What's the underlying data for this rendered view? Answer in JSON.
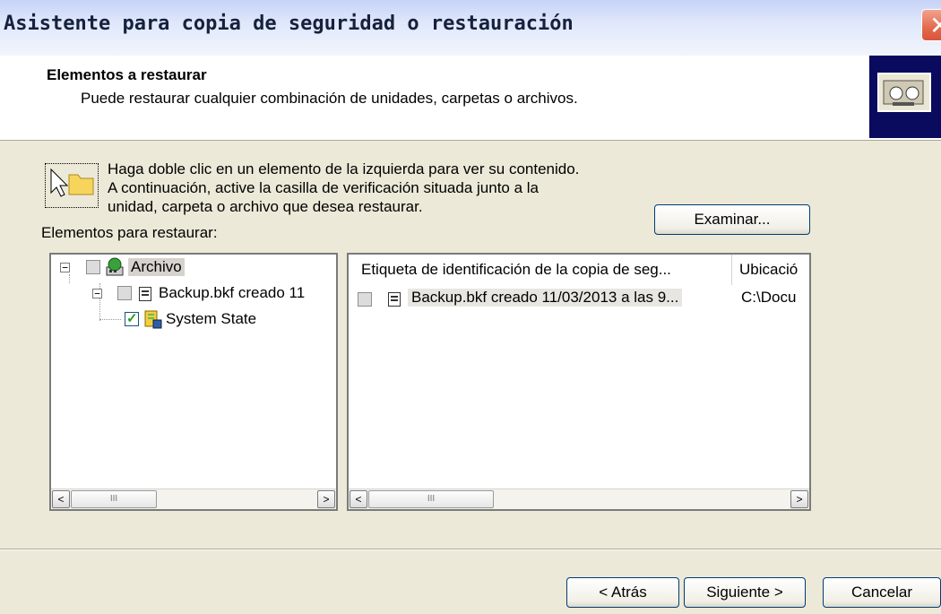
{
  "window": {
    "title": "Asistente para copia de seguridad o restauración"
  },
  "header": {
    "title": "Elementos a restaurar",
    "subtitle": "Puede restaurar cualquier combinación de unidades, carpetas o archivos."
  },
  "hint": {
    "line1": "Haga doble clic en un elemento de la izquierda para ver su contenido.",
    "line2": "A continuación, active la casilla de verificación situada junto a la",
    "line3": "unidad, carpeta o archivo que desea restaurar."
  },
  "items_label": "Elementos para restaurar:",
  "browse_label": "Examinar...",
  "tree": {
    "root": {
      "label": "Archivo",
      "expander": "−"
    },
    "child": {
      "label": "Backup.bkf creado 11",
      "expander": "−"
    },
    "grandchild": {
      "label": "System State",
      "checked": true
    }
  },
  "list": {
    "columns": [
      "Etiqueta de identificación de la copia de seg...",
      "Ubicació"
    ],
    "rows": [
      {
        "label": "Backup.bkf creado 11/03/2013 a las 9...",
        "location": "C:\\Docu"
      }
    ]
  },
  "scroll": {
    "left_arrow": "<",
    "right_arrow": ">",
    "grip": "III"
  },
  "footer": {
    "back": "< Atrás",
    "next": "Siguiente >",
    "cancel": "Cancelar"
  },
  "colors": {
    "window_bg": "#ece9d8",
    "title_text": "#16213d",
    "selection": "#d6d3ce",
    "border_blue": "#003c74"
  }
}
